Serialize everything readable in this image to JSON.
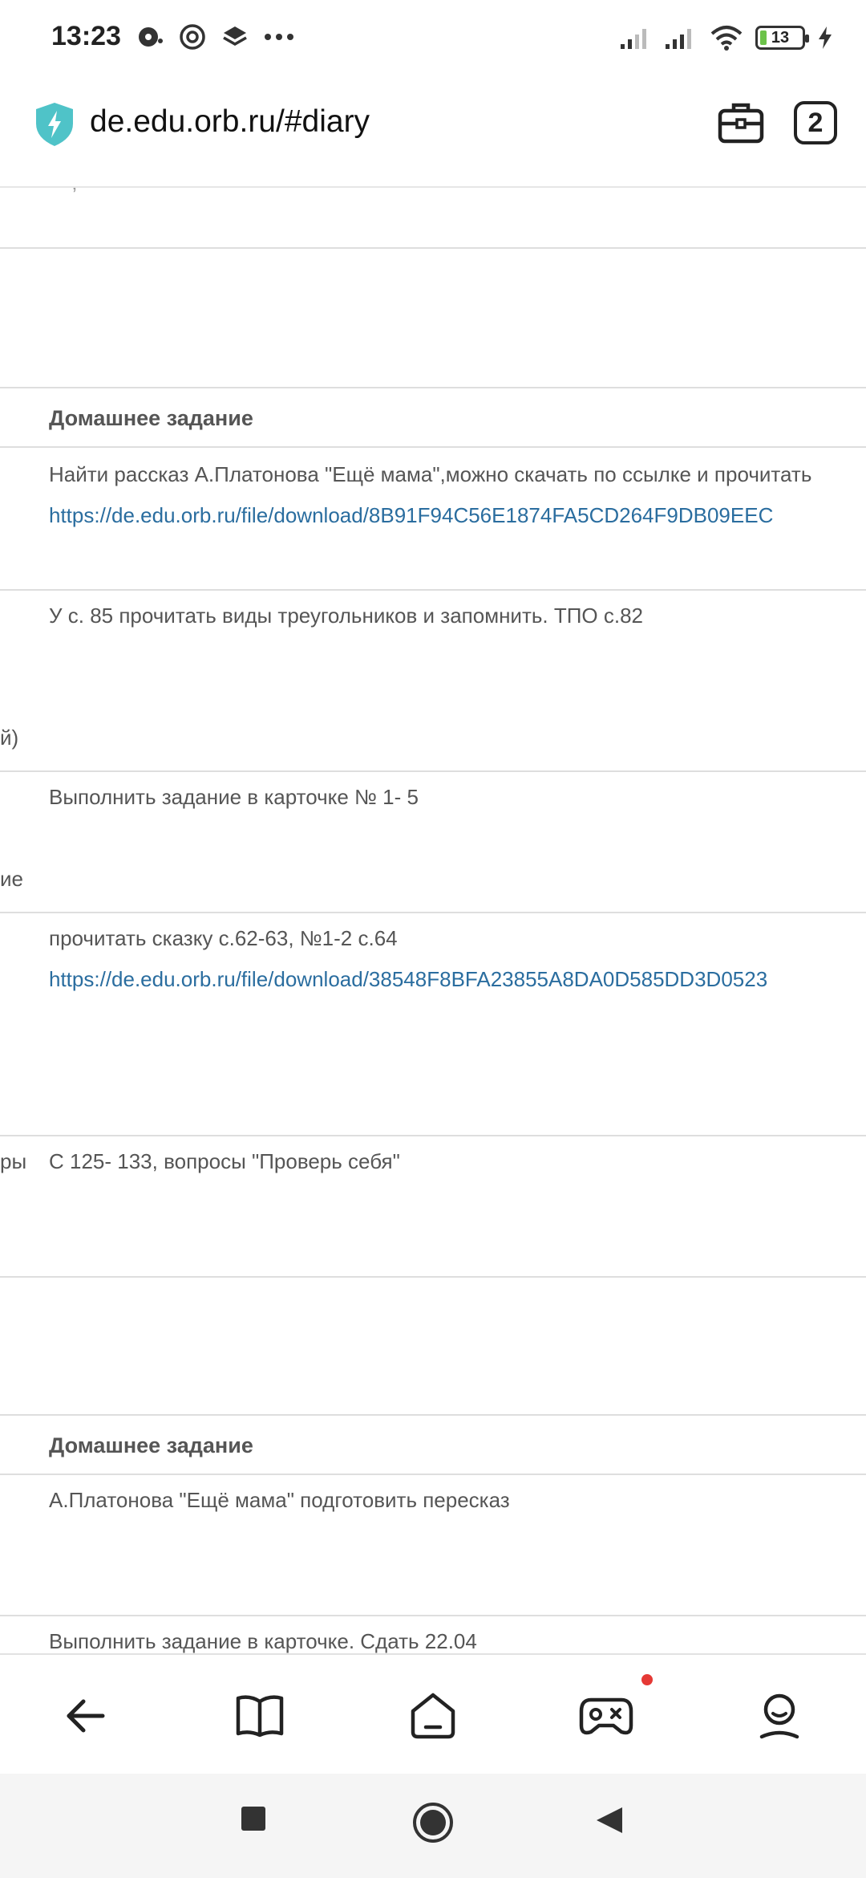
{
  "status": {
    "time": "13:23",
    "battery": "13"
  },
  "browser": {
    "url": "de.edu.orb.ru/#diary",
    "tab_count": "2"
  },
  "diary": {
    "header1": "Домашнее задание",
    "rows1": [
      {
        "text": "Найти рассказ А.Платонова \"Ещё мама\",можно скачать по ссылке и прочитать",
        "link": "https://de.edu.orb.ru/file/download/8B91F94C56E1874FA5CD264F9DB09EEC"
      },
      {
        "text": "У с. 85 прочитать виды треугольников и запомнить. ТПО с.82",
        "left_fragment": "й)"
      },
      {
        "text": "Выполнить задание в карточке № 1- 5",
        "left_fragment": "ие"
      },
      {
        "text": "прочитать сказку с.62-63, №1-2 с.64",
        "link": "https://de.edu.orb.ru/file/download/38548F8BFA23855A8DA0D585DD3D0523"
      },
      {
        "text": "С 125- 133, вопросы \"Проверь себя\"",
        "left_fragment": "ры"
      }
    ],
    "header2": "Домашнее задание",
    "rows2": [
      {
        "text": "А.Платонова \"Ещё мама\" подготовить пересказ"
      },
      {
        "text": "Выполнить задание в карточке. Сдать 22.04"
      }
    ]
  },
  "bottom_nav": {
    "items": [
      "back-icon",
      "book-icon",
      "home-icon",
      "gamepad-icon",
      "profile-icon"
    ]
  },
  "colors": {
    "link": "#2a6d9f",
    "shield": "#4fc3c8",
    "notification": "#e53935"
  }
}
